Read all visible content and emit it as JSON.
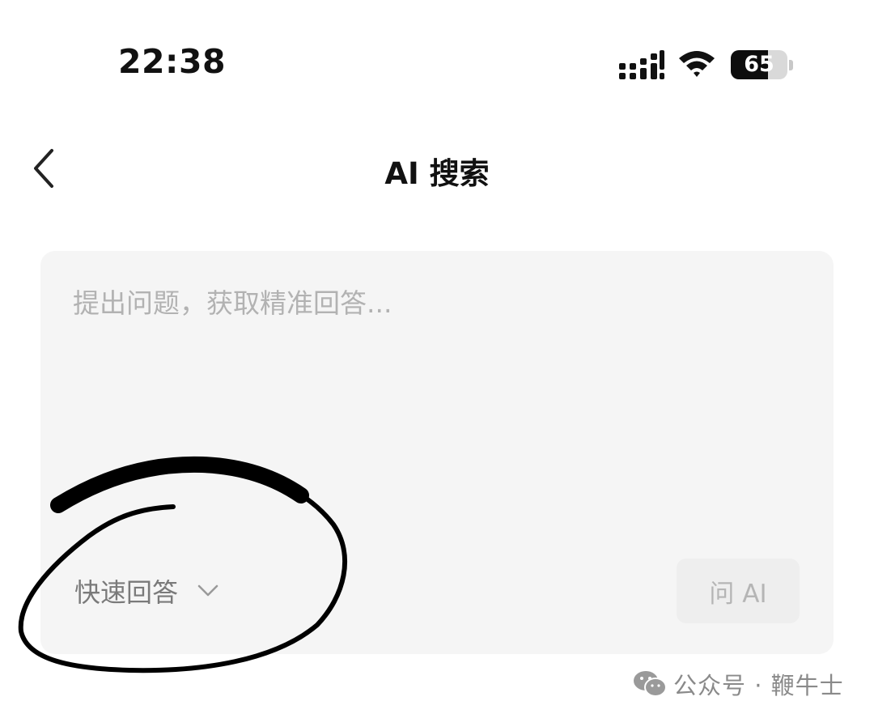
{
  "status_bar": {
    "time": "22:38",
    "battery_level": "65",
    "battery_fraction": 0.65,
    "icons": [
      "signal-icon",
      "wifi-icon",
      "battery-icon"
    ]
  },
  "nav": {
    "back_icon": "chevron-left-icon",
    "title": "AI 搜索"
  },
  "query_card": {
    "placeholder": "提出问题，获取精准回答...",
    "value": "",
    "mode_selected": "快速回答",
    "mode_icon": "chevron-down-icon",
    "ask_button_label": "问 AI"
  },
  "watermark": {
    "icon": "wechat-icon",
    "text": "公众号 · 鞭牛士"
  },
  "colors": {
    "card_background": "#f5f5f5",
    "placeholder": "#b2b2b2",
    "ask_button_background": "#eeeeee",
    "annotation_ink": "#000000"
  }
}
